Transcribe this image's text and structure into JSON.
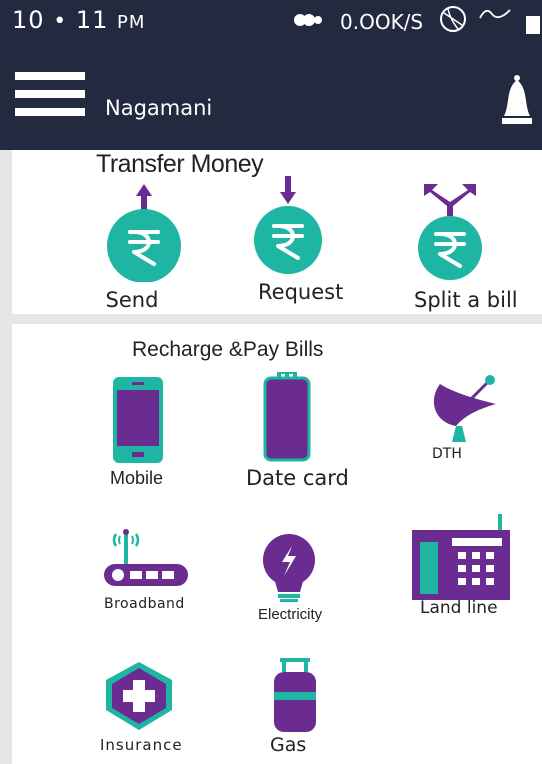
{
  "status_bar": {
    "time": "10",
    "time_minutes": "11",
    "period": "PM",
    "network_speed": "0.OOK/S"
  },
  "header": {
    "user_name": "Nagamani",
    "menu_icon": "hamburger-menu-icon",
    "notification_icon": "bell-icon"
  },
  "transfer": {
    "title": "Transfer Money",
    "actions": [
      {
        "label": "Send",
        "icon": "rupee-send-icon"
      },
      {
        "label": "Request",
        "icon": "rupee-request-icon"
      },
      {
        "label": "Split a bill",
        "icon": "rupee-split-icon"
      }
    ]
  },
  "recharge": {
    "title": "Recharge &Pay Bills",
    "items": [
      {
        "label": "Mobile",
        "icon": "mobile-phone-icon"
      },
      {
        "label": "Date card",
        "icon": "data-card-icon"
      },
      {
        "label": "DTH",
        "icon": "satellite-dish-icon"
      },
      {
        "label": "Broadband",
        "icon": "router-icon"
      },
      {
        "label": "Electricity",
        "icon": "lightbulb-icon"
      },
      {
        "label": "Land line",
        "icon": "landline-phone-icon"
      },
      {
        "label": "Insurance",
        "icon": "insurance-cross-icon"
      },
      {
        "label": "Gas",
        "icon": "gas-cylinder-icon"
      }
    ]
  },
  "colors": {
    "header_bg": "#232a40",
    "accent_teal": "#1fb5a3",
    "accent_purple": "#6a2c91",
    "page_bg": "#e6e6e6"
  }
}
